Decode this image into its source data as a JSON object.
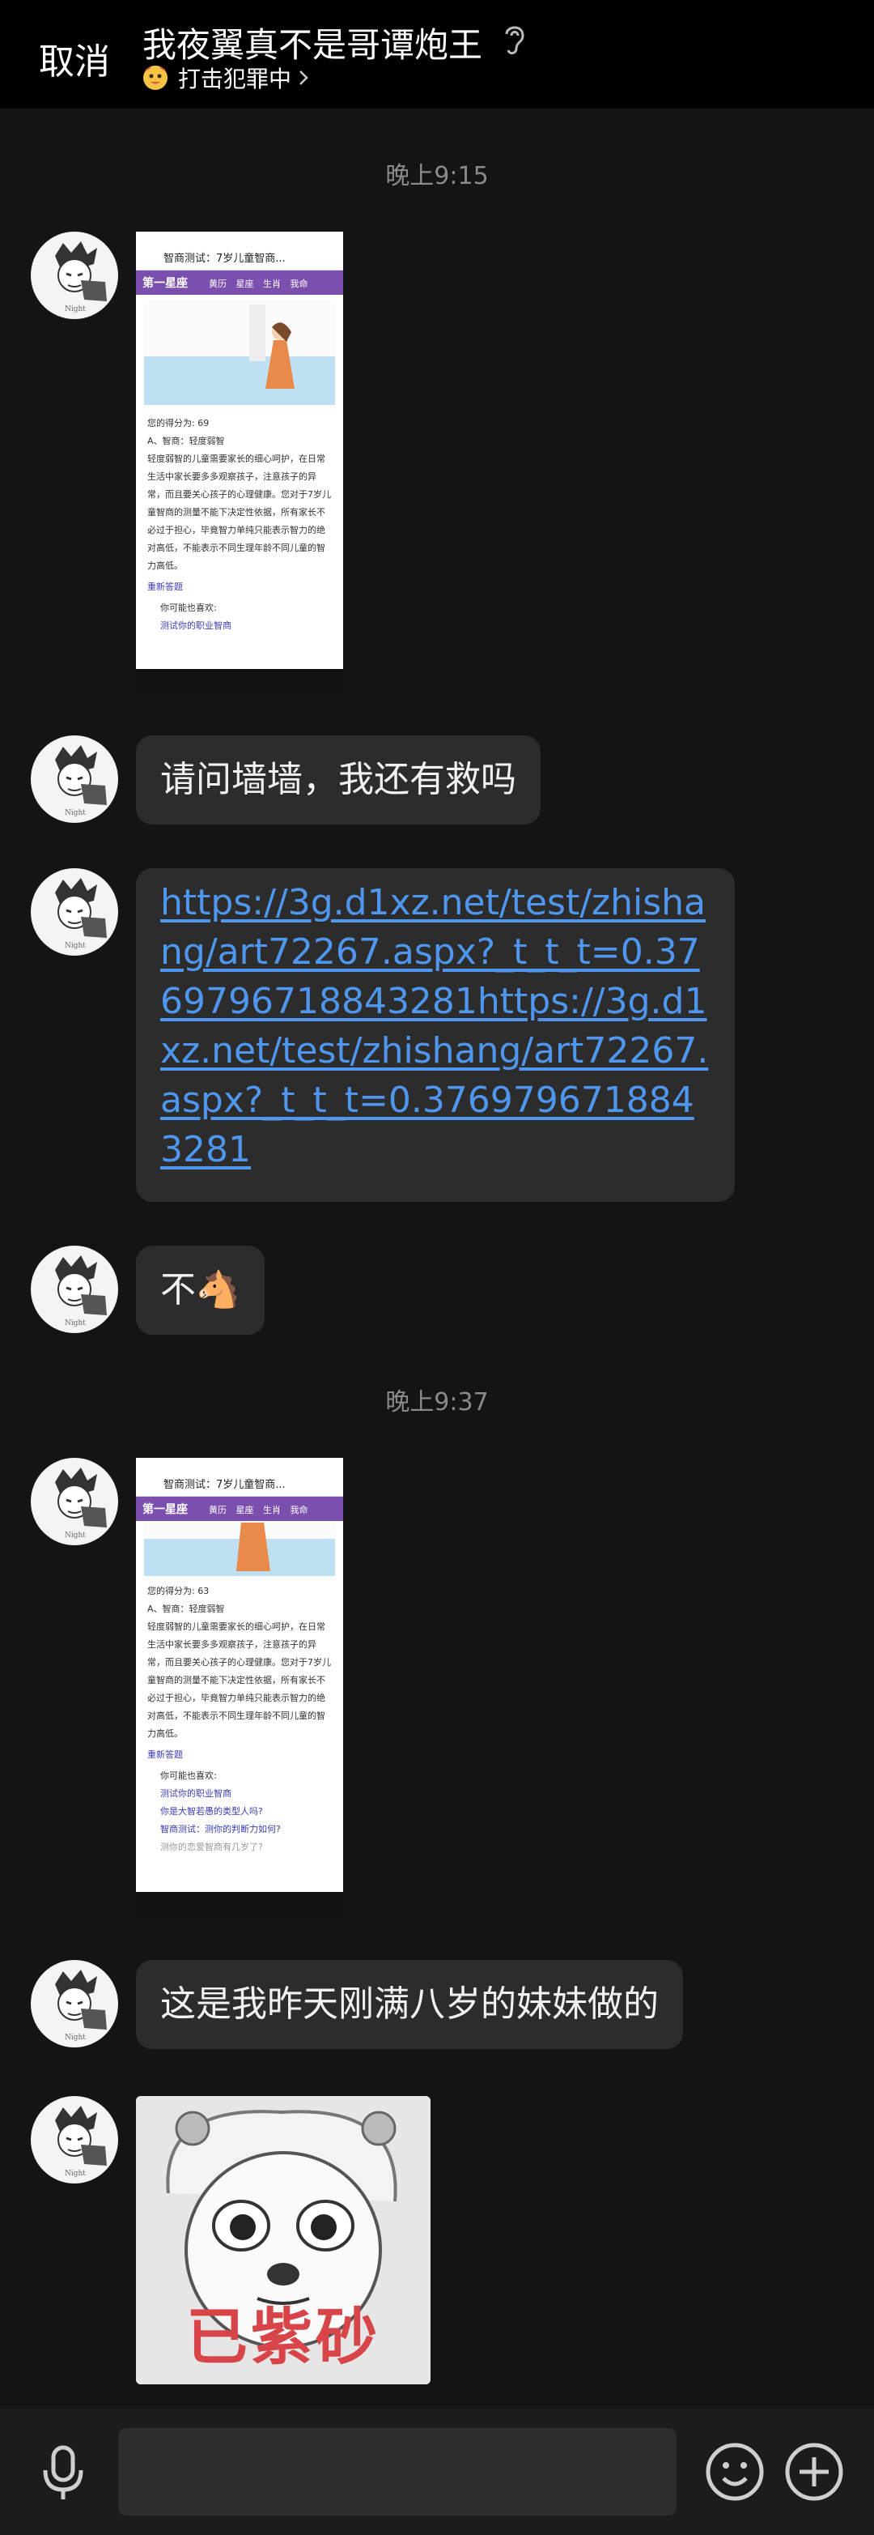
{
  "header": {
    "cancel_label": "取消",
    "title": "我夜翼真不是哥谭炮王",
    "status_text": "打击犯罪中"
  },
  "messages": {
    "time1": "晚上9:15",
    "time2": "晚上9:37",
    "msg_ask": "请问墙墙，我还有救吗",
    "msg_link": "https://3g.d1xz.net/test/zhishang/art72267.aspx?_t_t_t=0.3769796718843281https://3g.d1xz.net/test/zhishang/art72267.aspx?_t_t_t=0.3769796718843281",
    "msg_no": "不🐴",
    "msg_sister": "这是我昨天刚满八岁的妹妹做的",
    "meme_caption": "已紫砂"
  },
  "screenshot1": {
    "title": "智商测试：7岁儿童智商...",
    "logo": "第一星座",
    "nav": "黄历 星座 生肖 我命",
    "score": "您的得分为: 69",
    "level": "A、智商：轻度弱智",
    "desc": "轻度弱智的儿童需要家长的细心呵护，在日常生活中家长要多多观察孩子，注意孩子的异常，而且要关心孩子的心理健康。您对于7岁儿童智商的测量不能下决定性依据，所有家长不必过于担心，毕竟智力单纯只能表示智力的绝对高低，不能表示不同生理年龄不同儿童的智力高低。",
    "retest": "重新答题",
    "maybe": "你可能也喜欢:",
    "rec1": "测试你的职业智商"
  },
  "screenshot2": {
    "title": "智商测试：7岁儿童智商...",
    "logo": "第一星座",
    "nav": "黄历 星座 生肖 我命",
    "score": "您的得分为: 63",
    "level": "A、智商：轻度弱智",
    "desc": "轻度弱智的儿童需要家长的细心呵护，在日常生活中家长要多多观察孩子，注意孩子的异常，而且要关心孩子的心理健康。您对于7岁儿童智商的测量不能下决定性依据，所有家长不必过于担心，毕竟智力单纯只能表示智力的绝对高低，不能表示不同生理年龄不同儿童的智力高低。",
    "retest": "重新答题",
    "maybe": "你可能也喜欢:",
    "rec1": "测试你的职业智商",
    "rec2": "你是大智若愚的类型人吗?",
    "rec3": "智商测试：测你的判断力如何?",
    "rec4": "测你的恋爱智商有几岁了?"
  },
  "colors": {
    "background": "#141414",
    "bubble": "#2c2c2c",
    "link": "#4f97ee",
    "nav_purple": "#7b4fae"
  }
}
